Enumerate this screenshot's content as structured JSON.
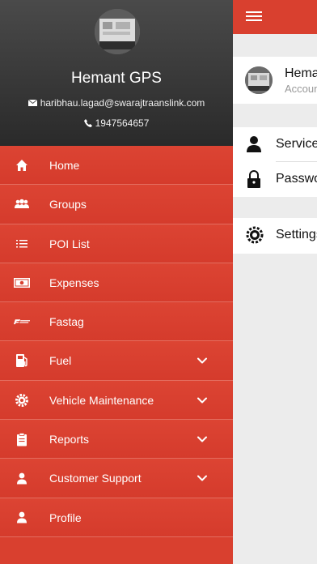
{
  "background_screen": {
    "profile_name": "Hemant GPS",
    "profile_sub": "Account",
    "rows": [
      {
        "label": "Services",
        "icon": "person-icon"
      },
      {
        "label": "Password",
        "icon": "lock-icon"
      }
    ],
    "settings_label": "Settings"
  },
  "drawer": {
    "user_name": "Hemant GPS",
    "email": "haribhau.lagad@swarajtraanslink.com",
    "phone": "1947564657",
    "menu": [
      {
        "label": "Home",
        "icon": "home-icon",
        "expandable": false
      },
      {
        "label": "Groups",
        "icon": "groups-icon",
        "expandable": false
      },
      {
        "label": "POI List",
        "icon": "list-icon",
        "expandable": false
      },
      {
        "label": "Expenses",
        "icon": "money-icon",
        "expandable": false
      },
      {
        "label": "Fastag",
        "icon": "fastag-icon",
        "expandable": false
      },
      {
        "label": "Fuel",
        "icon": "fuel-icon",
        "expandable": true
      },
      {
        "label": "Vehicle Maintenance",
        "icon": "gear-icon",
        "expandable": true
      },
      {
        "label": "Reports",
        "icon": "clipboard-icon",
        "expandable": true
      },
      {
        "label": "Customer Support",
        "icon": "person-icon",
        "expandable": true
      },
      {
        "label": "Profile",
        "icon": "person-icon",
        "expandable": false
      }
    ]
  },
  "colors": {
    "accent": "#d9402f",
    "header_dark": "#2a2a2a",
    "background": "#ececec"
  }
}
